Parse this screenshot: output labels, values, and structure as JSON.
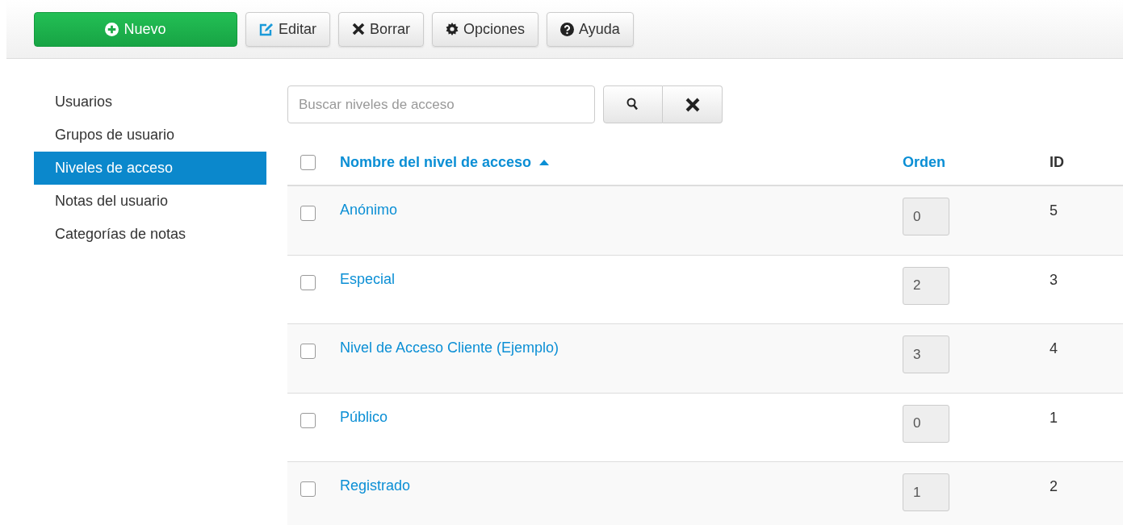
{
  "toolbar": [
    {
      "label": "Nuevo",
      "kind": "primary"
    },
    {
      "label": "Editar",
      "kind": "default"
    },
    {
      "label": "Borrar",
      "kind": "default"
    },
    {
      "label": "Opciones",
      "kind": "default"
    },
    {
      "label": "Ayuda",
      "kind": "default"
    }
  ],
  "sidebar": {
    "items": [
      {
        "label": "Usuarios",
        "selected": false
      },
      {
        "label": "Grupos de usuario",
        "selected": false
      },
      {
        "label": "Niveles de acceso",
        "selected": true
      },
      {
        "label": "Notas del usuario",
        "selected": false
      },
      {
        "label": "Categorías de notas",
        "selected": false
      }
    ]
  },
  "search": {
    "placeholder": "Buscar niveles de acceso"
  },
  "table": {
    "select_all": {
      "checked": false
    },
    "columns": [
      {
        "label": "Nombre del nivel de acceso",
        "sorted": true
      },
      {
        "label": "Orden",
        "sorted": false
      },
      {
        "label": "ID",
        "sorted": false
      }
    ],
    "rows": [
      {
        "checked": false,
        "name": "Anónimo",
        "order": "0",
        "id": "5"
      },
      {
        "checked": false,
        "name": "Especial",
        "order": "2",
        "id": "3"
      },
      {
        "checked": false,
        "name": "Nivel de Acceso Cliente (Ejemplo)",
        "order": "3",
        "id": "4"
      },
      {
        "checked": false,
        "name": "Público",
        "order": "0",
        "id": "1"
      },
      {
        "checked": false,
        "name": "Registrado",
        "order": "1",
        "id": "2"
      }
    ]
  }
}
